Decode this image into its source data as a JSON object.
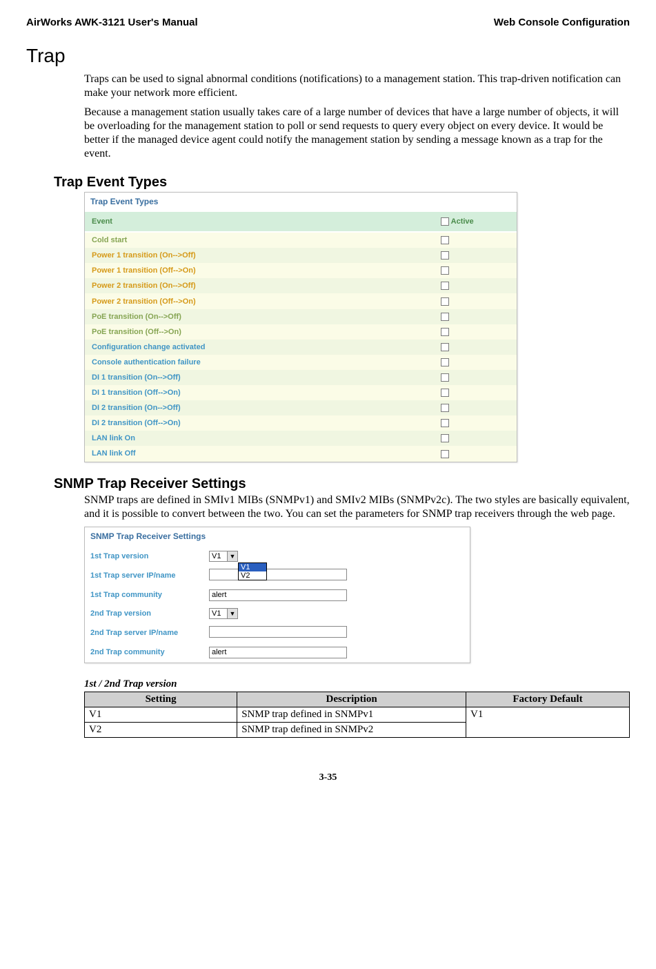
{
  "header": {
    "left": "AirWorks AWK-3121 User's Manual",
    "right": "Web Console Configuration"
  },
  "section_title": "Trap",
  "para1": "Traps can be used to signal abnormal conditions (notifications) to a management station. This trap-driven notification can make your network more efficient.",
  "para2": "Because a management station usually takes care of a large number of devices that have a large number of objects, it will be overloading for the management station to poll or send requests to query every object on every device. It would be better if the managed device agent could notify the management station by sending a message known as a trap for the event.",
  "trap_event_types_heading": "Trap Event Types",
  "panel1": {
    "title": "Trap Event Types",
    "col_event": "Event",
    "col_active": "Active",
    "rows": [
      {
        "label": "Cold start",
        "css": "evt-row-a"
      },
      {
        "label": "Power 1 transition (On-->Off)",
        "css": "evt-row-b"
      },
      {
        "label": "Power 1 transition (Off-->On)",
        "css": "evt-row-a1"
      },
      {
        "label": "Power 2 transition (On-->Off)",
        "css": "evt-row-b"
      },
      {
        "label": "Power 2 transition (Off-->On)",
        "css": "evt-row-a1"
      },
      {
        "label": "PoE transition (On-->Off)",
        "css": "evt-row-b1"
      },
      {
        "label": "PoE transition (Off-->On)",
        "css": "evt-row-a"
      },
      {
        "label": "Configuration change activated",
        "css": "evt-row-c1"
      },
      {
        "label": "Console authentication failure",
        "css": "evt-row-c"
      },
      {
        "label": "DI 1 transition (On-->Off)",
        "css": "evt-row-c1"
      },
      {
        "label": "DI 1 transition (Off-->On)",
        "css": "evt-row-c"
      },
      {
        "label": "DI 2 transition (On-->Off)",
        "css": "evt-row-c1"
      },
      {
        "label": "DI 2 transition (Off-->On)",
        "css": "evt-row-c"
      },
      {
        "label": "LAN link On",
        "css": "evt-row-c1"
      },
      {
        "label": "LAN link Off",
        "css": "evt-row-c"
      }
    ]
  },
  "snmp_heading": "SNMP Trap Receiver Settings",
  "snmp_para": "SNMP traps are defined in SMIv1 MIBs (SNMPv1) and SMIv2 MIBs (SNMPv2c). The two styles are basically equivalent, and it is possible to convert between the two. You can set the parameters for SNMP trap receivers through the web page.",
  "panel2": {
    "title": "SNMP Trap Receiver Settings",
    "rows": {
      "r1_label": "1st Trap version",
      "r1_value": "V1",
      "r1_dropdown": {
        "opt1": "V1",
        "opt2": "V2"
      },
      "r2_label": "1st Trap server IP/name",
      "r2_value": "",
      "r3_label": "1st Trap community",
      "r3_value": "alert",
      "r4_label": "2nd Trap version",
      "r4_value": "V1",
      "r5_label": "2nd Trap server IP/name",
      "r5_value": "",
      "r6_label": "2nd Trap community",
      "r6_value": "alert"
    }
  },
  "version_caption": "1st / 2nd Trap version",
  "sfd_table": {
    "h1": "Setting",
    "h2": "Description",
    "h3": "Factory Default",
    "r1c1": "V1",
    "r1c2": "SNMP trap defined in SNMPv1",
    "r2c1": "V2",
    "r2c2": "SNMP trap defined in SNMPv2",
    "fd": "V1"
  },
  "page_number": "3-35"
}
